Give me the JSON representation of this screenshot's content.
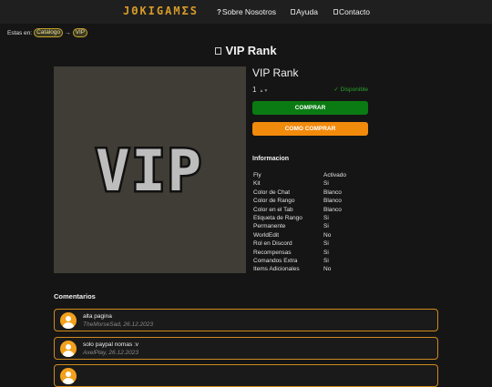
{
  "header": {
    "logo": "JΘKIGAMΣS",
    "nav": [
      {
        "icon": "?",
        "label": "Sobre Nosotros"
      },
      {
        "icon": "box",
        "label": "Ayuda"
      },
      {
        "icon": "box",
        "label": "Contacto"
      }
    ]
  },
  "breadcrumb": {
    "prefix": "Estas en:",
    "items": [
      "Catalogo",
      "VIP"
    ],
    "separator": "→"
  },
  "page": {
    "title": "VIP Rank"
  },
  "product": {
    "image_text": "VIP",
    "name": "VIP Rank",
    "quantity": "1",
    "stock": "✓ Disponible",
    "buy_label": "COMPRAR",
    "gift_label": "COMO COMPRAR",
    "info_title": "Informacion",
    "features": [
      {
        "name": "Fly",
        "value": "Activado"
      },
      {
        "name": "Kit",
        "value": "Si"
      },
      {
        "name": "Color de Chat",
        "value": "Blanco"
      },
      {
        "name": "Color de Rango",
        "value": "Blanco"
      },
      {
        "name": "Color en el Tab",
        "value": "Blanco"
      },
      {
        "name": "Etiqueta de Rango",
        "value": "Si"
      },
      {
        "name": "Permanente",
        "value": "Si"
      },
      {
        "name": "WorldEdit",
        "value": "No"
      },
      {
        "name": "Rol en Discord",
        "value": "Si"
      },
      {
        "name": "Recompensas",
        "value": "Si"
      },
      {
        "name": "Comandos Extra",
        "value": "Si"
      },
      {
        "name": "Items Adicionales",
        "value": "No"
      }
    ]
  },
  "comments": {
    "title": "Comentarios",
    "items": [
      {
        "text": "alta pagina",
        "meta": "TheMorseSad, 26.12.2023"
      },
      {
        "text": "solo paypal nomas :v",
        "meta": "AxelPlay, 26.12.2023"
      }
    ]
  },
  "colors": {
    "accent": "#d69a2a",
    "buy": "#0a7b12",
    "gift": "#f28a0c",
    "stock": "#2aa12a",
    "comment_border": "#d08a1c"
  }
}
